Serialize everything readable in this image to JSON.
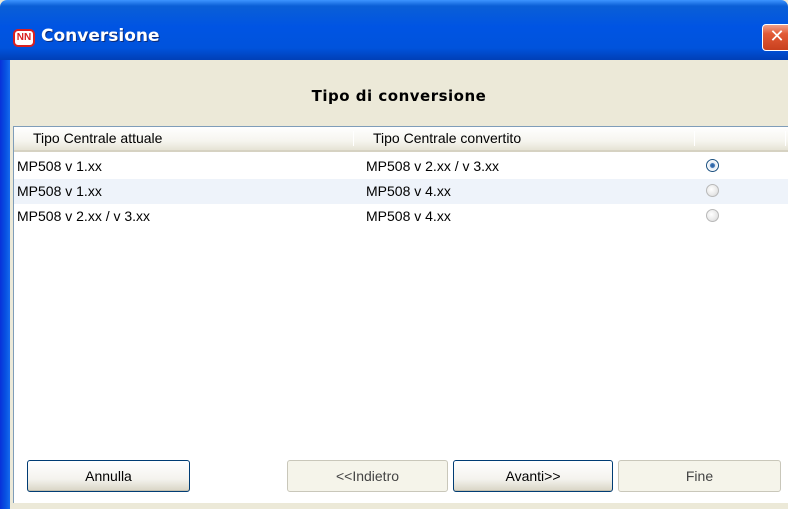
{
  "window": {
    "title": "Conversione",
    "icon_text": "NN",
    "close_label": "✕"
  },
  "header": {
    "title": "Tipo di conversione"
  },
  "table": {
    "columns": [
      "Tipo Centrale attuale",
      "Tipo Centrale convertito",
      ""
    ],
    "rows": [
      {
        "attuale": "MP508 v 1.xx",
        "convertito": "MP508 v 2.xx / v 3.xx",
        "selected": true
      },
      {
        "attuale": "MP508 v 1.xx",
        "convertito": "MP508 v 4.xx",
        "selected": false
      },
      {
        "attuale": "MP508 v 2.xx / v 3.xx",
        "convertito": "MP508 v 4.xx",
        "selected": false
      }
    ]
  },
  "buttons": {
    "cancel": "Annulla",
    "back": "<<Indietro",
    "next": "Avanti>>",
    "finish": "Fine"
  }
}
